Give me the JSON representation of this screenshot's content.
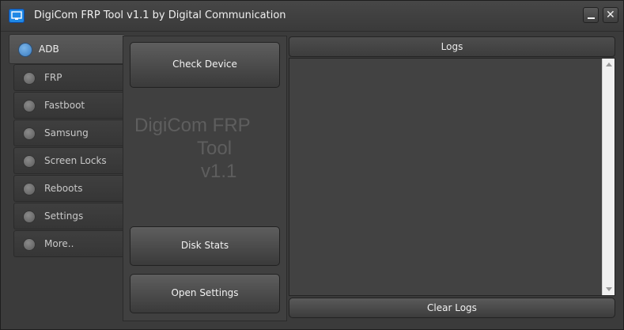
{
  "window": {
    "title": "DigiCom FRP Tool v1.1 by Digital Communication",
    "icon": "remote-desktop-icon",
    "controls": {
      "minimize_icon": "minimize-icon",
      "close_icon": "close-icon",
      "close_glyph": "✕"
    }
  },
  "sidebar": {
    "active_color": "#3a7cc0",
    "items": [
      {
        "label": "ADB",
        "active": true
      },
      {
        "label": "FRP"
      },
      {
        "label": "Fastboot"
      },
      {
        "label": "Samsung"
      },
      {
        "label": "Screen Locks"
      },
      {
        "label": "Reboots"
      },
      {
        "label": "Settings"
      },
      {
        "label": "More.."
      }
    ]
  },
  "panel": {
    "check_device": "Check Device",
    "brand_lines": [
      "DigiCom FRP",
      "Tool",
      "v1.1"
    ],
    "disk_stats": "Disk Stats",
    "open_settings": "Open Settings"
  },
  "logs": {
    "header": "Logs",
    "content": "",
    "clear_label": "Clear Logs"
  }
}
